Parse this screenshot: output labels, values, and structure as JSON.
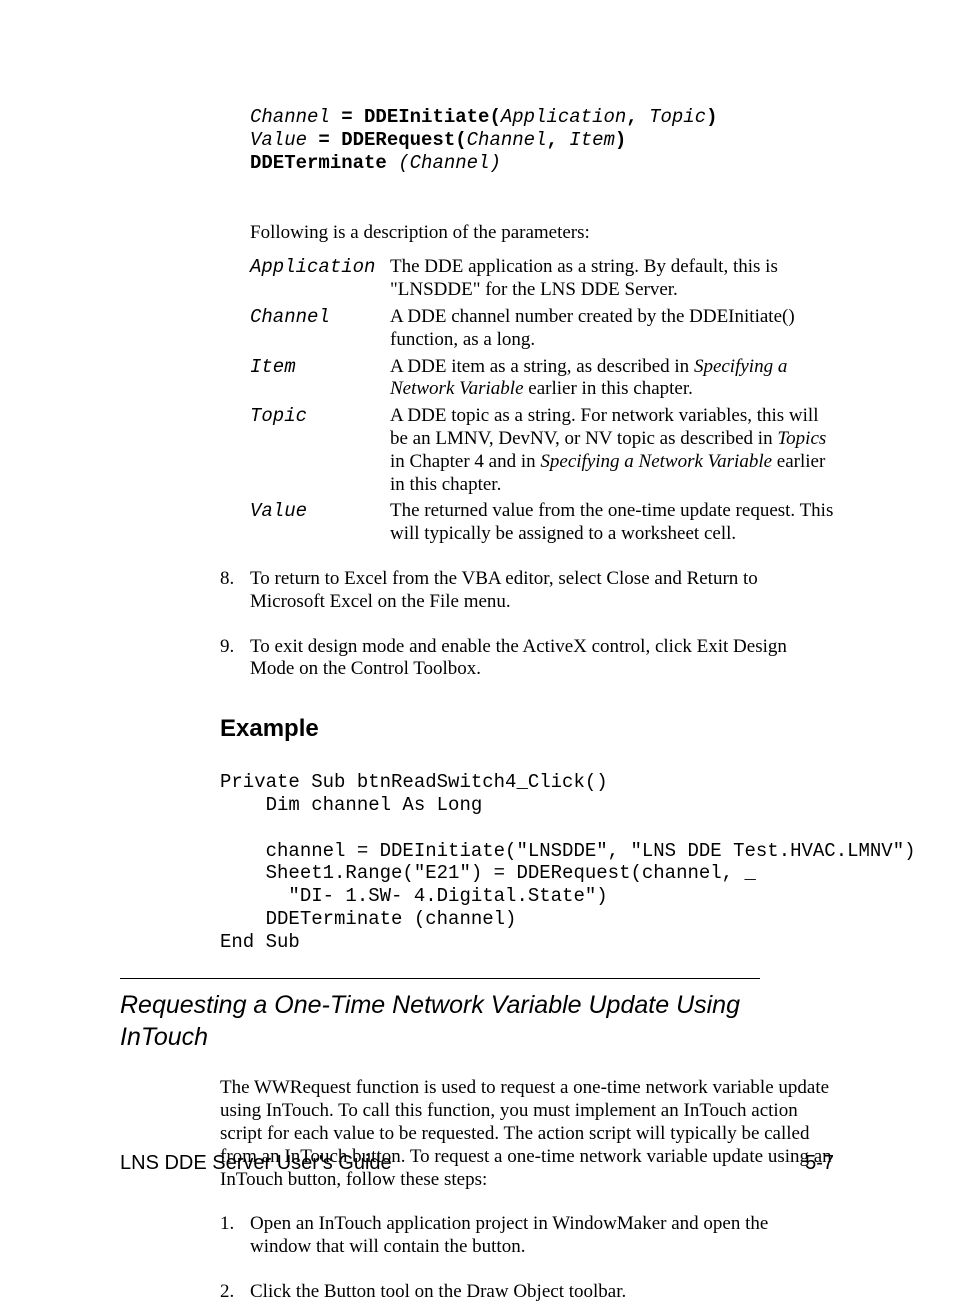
{
  "code1": {
    "l1a": "Channel",
    "l1b": " = DDEInitiate(",
    "l1c": "Application",
    "l1d": ", ",
    "l1e": "Topic",
    "l1f": ")",
    "l2a": "Value",
    "l2b": " = DDERequest(",
    "l2c": "Channel",
    "l2d": ", ",
    "l2e": "Item",
    "l2f": ")",
    "l3a": "DDETerminate ",
    "l3b": "(",
    "l3c": "Channel)"
  },
  "intro": "Following is a description of the parameters:",
  "params": {
    "app": {
      "name": "Application",
      "desc": "The DDE application as a string.  By default, this is \"LNSDDE\" for the LNS DDE Server."
    },
    "channel": {
      "name": "Channel",
      "desc": "A DDE channel number created by the DDEInitiate() function, as a long."
    },
    "item": {
      "name": "Item",
      "d1": "A DDE item as a string, as described in ",
      "d2": "Specifying a Network Variable",
      "d3": " earlier in this chapter."
    },
    "topic": {
      "name": "Topic",
      "d1": "A DDE topic as a string.  For network variables, this will be an LMNV, DevNV, or NV topic as described in ",
      "d2": "Topics",
      "d3": " in Chapter 4 and in ",
      "d4": "Specifying a Network Variable",
      "d5": " earlier in this chapter."
    },
    "value": {
      "name": "Value",
      "desc": "The returned value from the one-time update request.  This will typically be assigned to a worksheet cell."
    }
  },
  "list1": {
    "n8": {
      "num": "8.",
      "txt": "To return to Excel from the VBA editor, select Close and Return to Microsoft Excel on the File menu."
    },
    "n9": {
      "num": "9.",
      "txt": "To exit design mode and enable the ActiveX control, click Exit Design Mode on the Control Toolbox."
    }
  },
  "exampleHeading": "Example",
  "exampleCode": "Private Sub btnReadSwitch4_Click()\n    Dim channel As Long\n\n    channel = DDEInitiate(\"LNSDDE\", \"LNS DDE Test.HVAC.LMNV\")\n    Sheet1.Range(\"E21\") = DDERequest(channel, _\n      \"DI- 1.SW- 4.Digital.State\")\n    DDETerminate (channel)\nEnd Sub",
  "sectionTitle": "Requesting a One-Time Network Variable Update Using InTouch",
  "body": "The WWRequest function is used to request a one-time network variable update using InTouch.  To call this function, you must implement an InTouch action script for each value to be requested.  The action script will typically be called from an InTouch button.  To request a one-time network variable update using an InTouch button, follow these steps:",
  "list2": {
    "n1": {
      "num": "1.",
      "txt": "Open an InTouch application project in WindowMaker and open the window that will contain the button."
    },
    "n2": {
      "num": "2.",
      "txt": "Click the Button tool on the Draw Object toolbar."
    }
  },
  "footer": {
    "left": "LNS DDE Server User's Guide",
    "right": "5-7"
  }
}
